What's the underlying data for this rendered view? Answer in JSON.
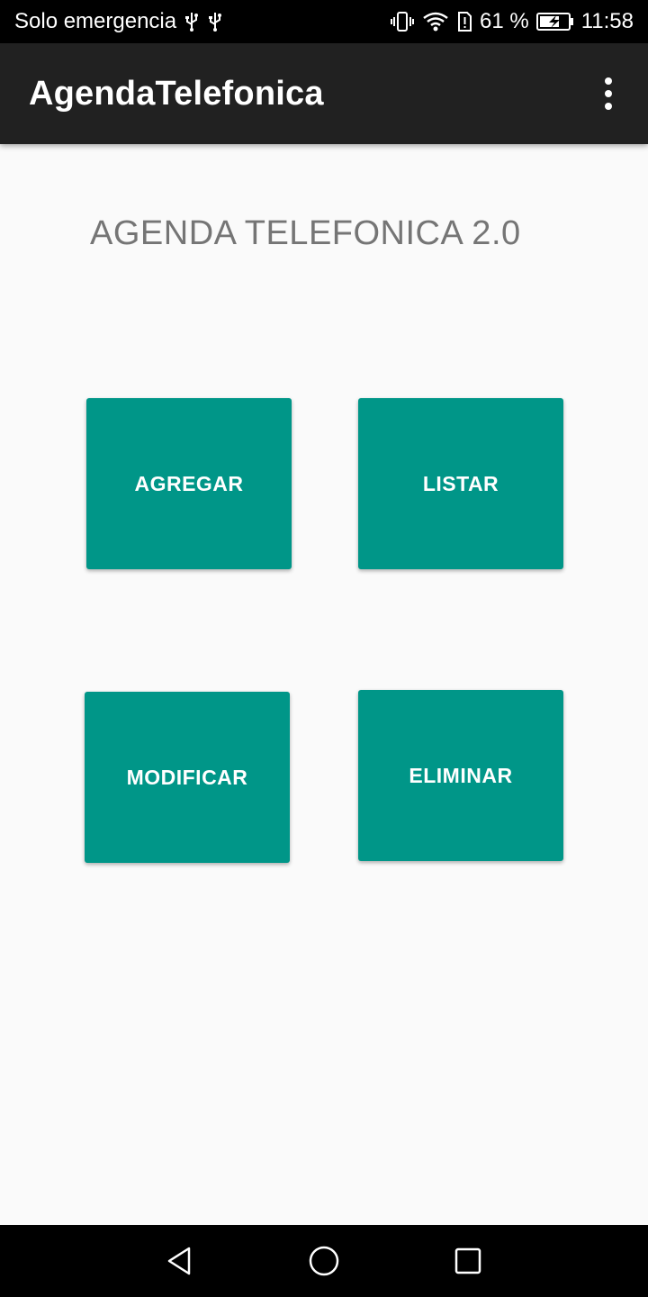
{
  "status_bar": {
    "carrier_text": "Solo emergencia",
    "battery_percent": "61 %",
    "time": "11:58",
    "left_icons": [
      "usb-icon",
      "usb-icon"
    ],
    "right_icons": [
      "vibrate-icon",
      "wifi-icon",
      "data-saver-icon",
      "battery-charging-icon"
    ]
  },
  "app_bar": {
    "title": "AgendaTelefonica",
    "menu_icon": "more-vert-icon"
  },
  "main": {
    "heading": "AGENDA TELEFONICA 2.0",
    "buttons": {
      "agregar": "AGREGAR",
      "listar": "LISTAR",
      "modificar": "MODIFICAR",
      "eliminar": "ELIMINAR"
    }
  },
  "nav_bar": {
    "icons": [
      "back-icon",
      "home-icon",
      "recents-icon"
    ]
  },
  "colors": {
    "accent": "#009688",
    "app_bar": "#212121",
    "background": "#fafafa",
    "heading_text": "#757575"
  }
}
